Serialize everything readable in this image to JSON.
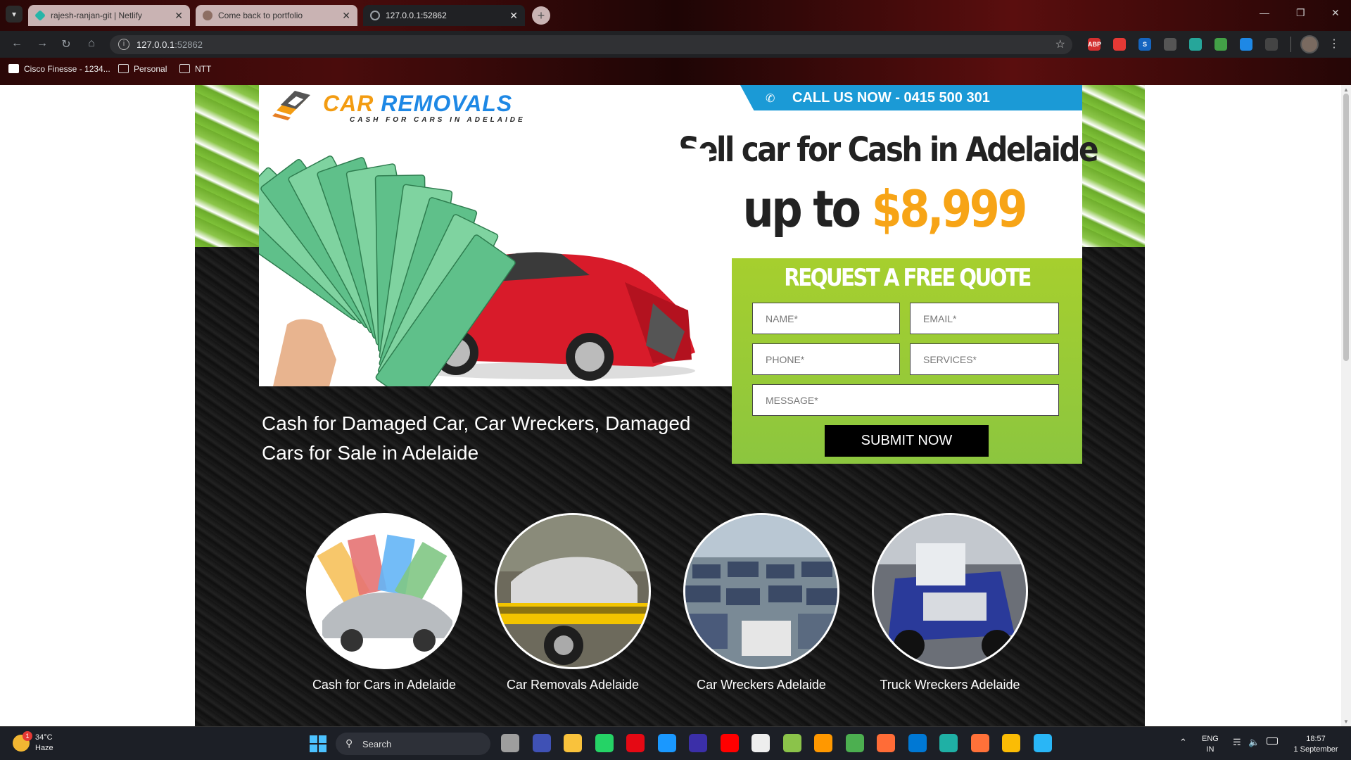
{
  "browser": {
    "tabs": [
      {
        "title": "rajesh-ranjan-git | Netlify",
        "active": false,
        "favicon_color": "#26b5a8"
      },
      {
        "title": "Come back to portfolio",
        "active": false,
        "favicon_color": "#8d6e63"
      },
      {
        "title": "127.0.0.1:52862",
        "active": true,
        "favicon_color": "#9aa0a6"
      }
    ],
    "url_host": "127.0.0.1",
    "url_port": ":52862",
    "bookmarks": [
      {
        "label": "Cisco Finesse - 1234...",
        "icon": "cisco-icon"
      },
      {
        "label": "Personal",
        "icon": "folder-icon"
      },
      {
        "label": "NTT",
        "icon": "folder-icon"
      }
    ],
    "extensions": [
      {
        "name": "adblock-plus-icon",
        "text": "ABP",
        "color": "#d32f2f"
      },
      {
        "name": "shield-extension-icon",
        "text": "",
        "color": "#e53935"
      },
      {
        "name": "s-extension-icon",
        "text": "S",
        "color": "#1565c0"
      },
      {
        "name": "target-extension-icon",
        "text": "",
        "color": "#555555"
      },
      {
        "name": "atom-extension-icon",
        "text": "",
        "color": "#26a69a"
      },
      {
        "name": "colorful-extension-icon",
        "text": "",
        "color": "#43a047"
      },
      {
        "name": "docs-extension-icon",
        "text": "",
        "color": "#1e88e5"
      },
      {
        "name": "puzzle-extensions-icon",
        "text": "",
        "color": "#444444"
      }
    ]
  },
  "site": {
    "logo": {
      "word1": "CAR",
      "word2": "REMOVALS",
      "tagline": "CASH FOR CARS IN ADELAIDE"
    },
    "call": "CALL US NOW - 0415 500 301",
    "headline_1": "Sell car for Cash in Adelaide",
    "headline_2_prefix": "up to ",
    "headline_2_price": "$8,999",
    "quote": {
      "title": "REQUEST A FREE QUOTE",
      "name_placeholder": "NAME*",
      "email_placeholder": "EMAIL*",
      "phone_placeholder": "PHONE*",
      "services_placeholder": "SERVICES*",
      "message_placeholder": "MESSAGE*",
      "submit": "SUBMIT NOW"
    },
    "tagline": "Cash for Damaged Car, Car Wreckers, Damaged Cars for Sale in Adelaide",
    "services": [
      {
        "label": "Cash for Cars in Adelaide"
      },
      {
        "label": "Car Removals Adelaide"
      },
      {
        "label": "Car Wreckers Adelaide"
      },
      {
        "label": "Truck Wreckers Adelaide"
      }
    ]
  },
  "taskbar": {
    "weather_temp": "34°C",
    "weather_desc": "Haze",
    "weather_badge": "1",
    "search": "Search",
    "lang_1": "ENG",
    "lang_2": "IN",
    "time": "18:57",
    "date": "1 September",
    "apps": [
      {
        "name": "file-manager-icon",
        "color": "#9e9e9e"
      },
      {
        "name": "store-icon",
        "color": "#3f51b5"
      },
      {
        "name": "folder-icon",
        "color": "#f9c23c"
      },
      {
        "name": "whatsapp-icon",
        "color": "#25d366"
      },
      {
        "name": "netflix-icon",
        "color": "#e50914"
      },
      {
        "name": "prime-video-icon",
        "color": "#1a98ff"
      },
      {
        "name": "amazon-music-icon",
        "color": "#3b2fa8"
      },
      {
        "name": "youtube-icon",
        "color": "#ff0000"
      },
      {
        "name": "github-icon",
        "color": "#eeeeee"
      },
      {
        "name": "notepad-icon",
        "color": "#8bc34a"
      },
      {
        "name": "sublime-icon",
        "color": "#ff9800"
      },
      {
        "name": "mongodb-icon",
        "color": "#4caf50"
      },
      {
        "name": "postman-icon",
        "color": "#ff6c37"
      },
      {
        "name": "vscode-icon",
        "color": "#0078d4"
      },
      {
        "name": "edge-icon",
        "color": "#1fb0a5"
      },
      {
        "name": "firefox-icon",
        "color": "#ff7139"
      },
      {
        "name": "chrome-icon",
        "color": "#fbbc05"
      },
      {
        "name": "globe-app-icon",
        "color": "#29b6f6"
      }
    ]
  }
}
